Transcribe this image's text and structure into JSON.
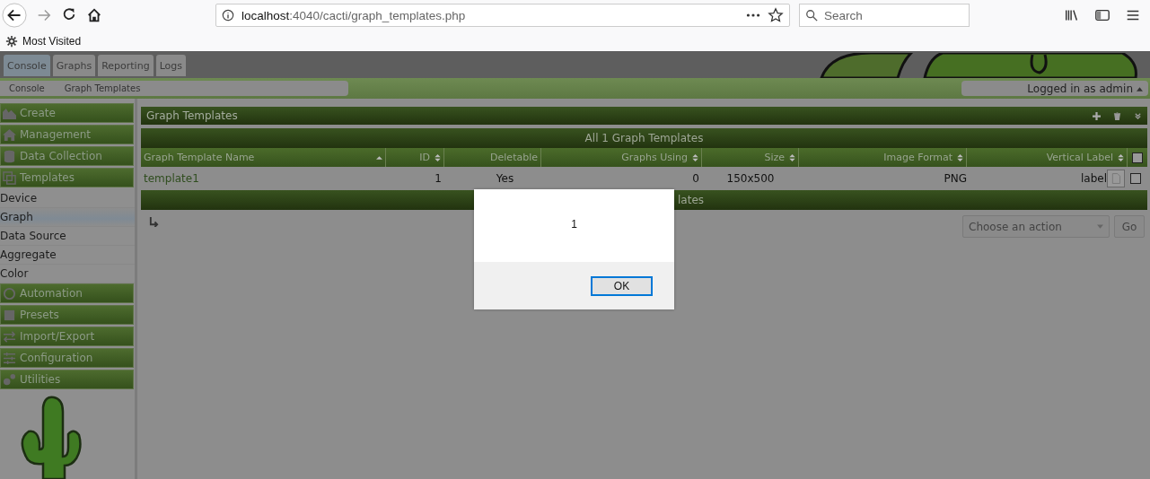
{
  "browser": {
    "url_host": "localhost",
    "url_path": ":4040/cacti/graph_templates.php",
    "search": {
      "placeholder": "Search"
    },
    "bookmarks": [
      "Most Visited"
    ]
  },
  "tabs": [
    {
      "label": "Console",
      "selected": true
    },
    {
      "label": "Graphs",
      "selected": false
    },
    {
      "label": "Reporting",
      "selected": false
    },
    {
      "label": "Logs",
      "selected": false
    }
  ],
  "breadcrumbs": [
    "Console",
    "Graph Templates"
  ],
  "user_menu": "Logged in as admin",
  "sidebar": [
    {
      "label": "Create"
    },
    {
      "label": "Management"
    },
    {
      "label": "Data Collection"
    },
    {
      "label": "Templates",
      "children": [
        {
          "label": "Device",
          "selected": false
        },
        {
          "label": "Graph",
          "selected": true
        },
        {
          "label": "Data Source",
          "selected": false
        },
        {
          "label": "Aggregate",
          "selected": false
        },
        {
          "label": "Color",
          "selected": false
        }
      ]
    },
    {
      "label": "Automation"
    },
    {
      "label": "Presets"
    },
    {
      "label": "Import/Export"
    },
    {
      "label": "Configuration"
    },
    {
      "label": "Utilities"
    }
  ],
  "panel": {
    "title": "Graph Templates",
    "caption": "All 1 Graph Templates",
    "columns": [
      {
        "label": "Graph Template Name",
        "kind": "ascending"
      },
      {
        "label": "ID",
        "kind": "sortable"
      },
      {
        "label": "Deletable",
        "kind": "plain"
      },
      {
        "label": "Graphs Using",
        "kind": "sortable"
      },
      {
        "label": "Size",
        "kind": "sortable"
      },
      {
        "label": "Image Format",
        "kind": "sortable"
      },
      {
        "label": "Vertical Label",
        "kind": "sortable"
      }
    ],
    "select_all": {
      "checked": false
    },
    "rows": [
      {
        "cells": [
          "template1",
          "1",
          "Yes",
          "0",
          "150x500",
          "PNG",
          "label"
        ],
        "checked": false
      }
    ],
    "footer": "lates",
    "action": {
      "placeholder": "Choose an action",
      "button": "Go"
    }
  },
  "dialog": {
    "message": "1",
    "button": "OK"
  }
}
